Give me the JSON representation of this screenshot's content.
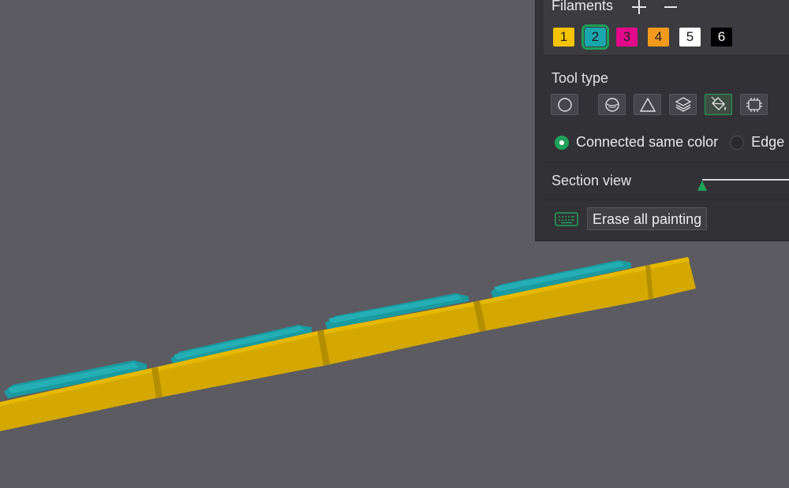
{
  "filaments": {
    "title": "Filaments",
    "add_icon": "plus-icon",
    "remove_icon": "minus-icon",
    "items": [
      {
        "label": "1",
        "color": "#f5c400",
        "text_color": "#222222"
      },
      {
        "label": "2",
        "color": "#1aa6ad",
        "text_color": "#1a1a1a",
        "selected": true
      },
      {
        "label": "3",
        "color": "#e20a8a",
        "text_color": "#222222"
      },
      {
        "label": "4",
        "color": "#f39a1d",
        "text_color": "#222222"
      },
      {
        "label": "5",
        "color": "#ffffff",
        "text_color": "#111111"
      },
      {
        "label": "6",
        "color": "#000000",
        "text_color": "#ffffff"
      }
    ]
  },
  "tool_type": {
    "title": "Tool type",
    "tools": [
      {
        "name": "circle-icon"
      },
      {
        "name": "sphere-icon"
      },
      {
        "name": "triangle-icon"
      },
      {
        "name": "height-range-icon"
      },
      {
        "name": "fill-bucket-icon",
        "active": true
      },
      {
        "name": "gap-fill-icon"
      }
    ]
  },
  "options": {
    "connected_same_color": "Connected same color",
    "edge_detection": "Edge"
  },
  "section_view": {
    "label": "Section view",
    "value": 0
  },
  "actions": {
    "shortcut_icon": "keyboard-icon",
    "erase_all": "Erase all painting"
  },
  "colors": {
    "accent": "#1fa15a",
    "panel_bg": "#323236",
    "viewport_bg": "#5b5b61",
    "model_base": "#d4a800",
    "model_painted": "#1aa6ad"
  }
}
